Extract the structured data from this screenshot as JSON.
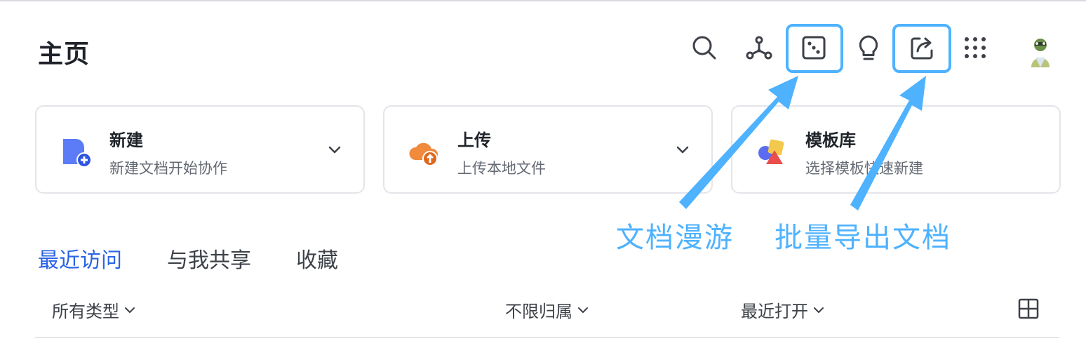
{
  "header": {
    "title": "主页",
    "icons": [
      "search-icon",
      "graph-nodes-icon",
      "dice-icon",
      "lightbulb-icon",
      "share-export-icon",
      "app-grid-icon"
    ]
  },
  "cards": [
    {
      "title": "新建",
      "subtitle": "新建文档开始协作",
      "icon": "new-doc-icon",
      "color": "#5b7cf6"
    },
    {
      "title": "上传",
      "subtitle": "上传本地文件",
      "icon": "upload-cloud-icon",
      "color": "#f08a3c"
    },
    {
      "title": "模板库",
      "subtitle": "选择模板快速新建",
      "icon": "template-shapes-icon",
      "color": "#f2c94c"
    }
  ],
  "annotations": {
    "wander": "文档漫游",
    "batch_export": "批量导出文档"
  },
  "tabs": [
    {
      "label": "最近访问",
      "active": true
    },
    {
      "label": "与我共享",
      "active": false
    },
    {
      "label": "收藏",
      "active": false
    }
  ],
  "filters": {
    "type": "所有类型",
    "owner": "不限归属",
    "sort": "最近打开"
  },
  "colors": {
    "accent": "#2a63e6",
    "highlight": "#4eb2ff",
    "text": "#1f2329",
    "muted": "#646a73",
    "border": "#e3e5e9"
  }
}
